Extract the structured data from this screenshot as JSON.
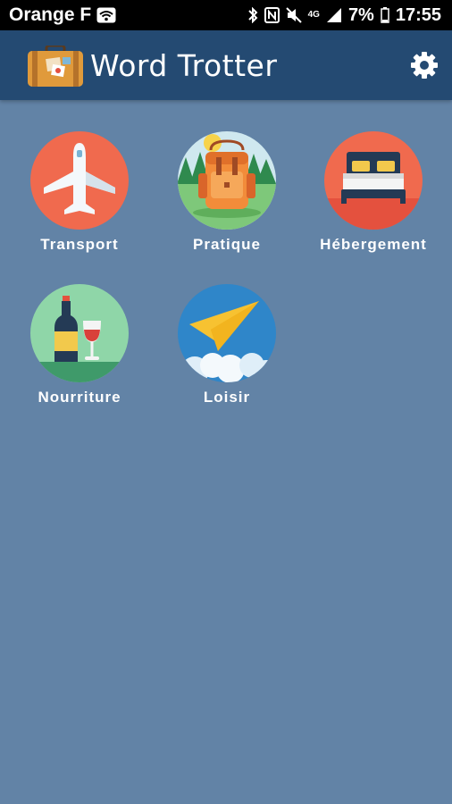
{
  "status_bar": {
    "carrier": "Orange F",
    "battery": "7%",
    "time": "17:55",
    "network": "4G"
  },
  "app_bar": {
    "title": "Word Trotter"
  },
  "categories": [
    {
      "label": "Transport",
      "color": "#f06a4e"
    },
    {
      "label": "Pratique",
      "color": "#7ec87a"
    },
    {
      "label": "Hébergement",
      "color": "#ef5f49"
    },
    {
      "label": "Nourriture",
      "color": "#8fd6a8"
    },
    {
      "label": "Loisir",
      "color": "#2f86c9"
    }
  ],
  "colors": {
    "background": "#6283a6",
    "app_bar": "#244a72",
    "status_bar": "#000000"
  }
}
